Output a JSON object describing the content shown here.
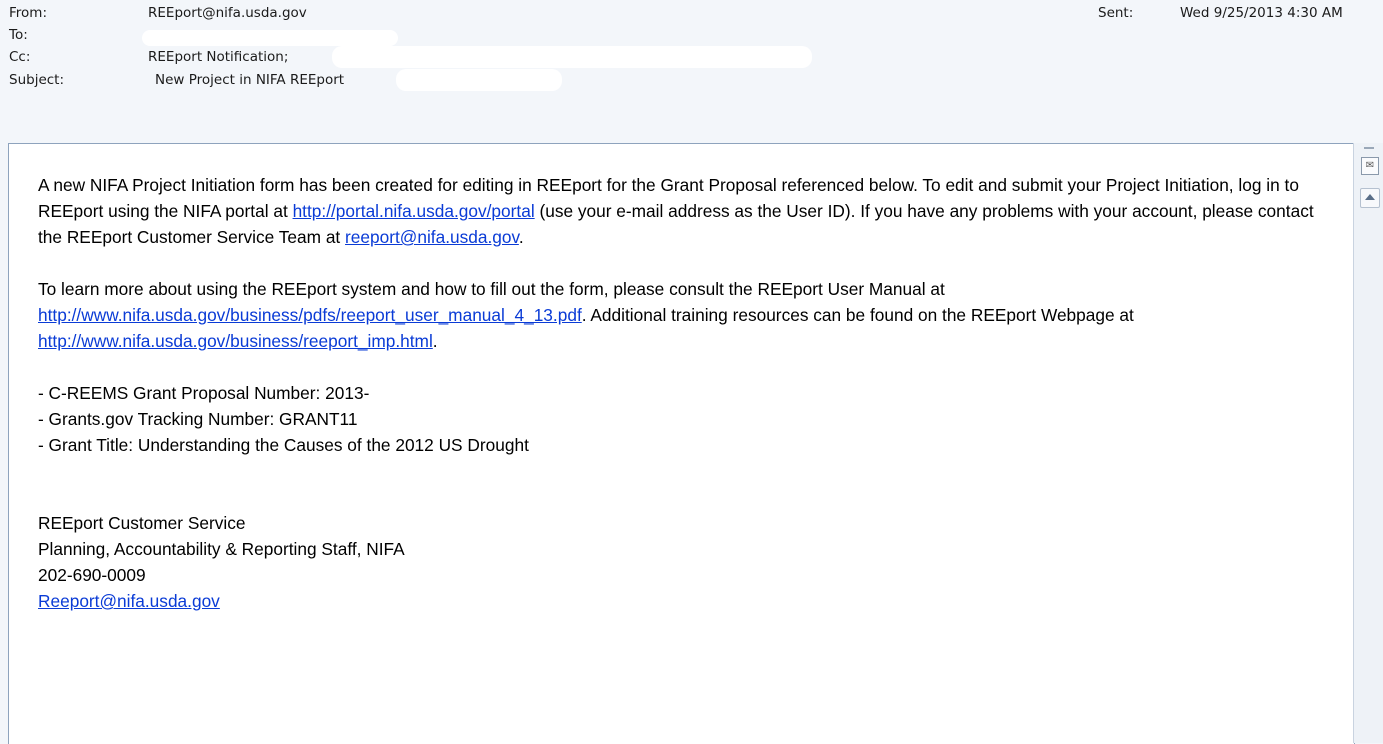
{
  "header": {
    "from_label": "From:",
    "from_value": "REEport@nifa.usda.gov",
    "to_label": "To:",
    "cc_label": "Cc:",
    "cc_value": "REEport Notification;",
    "subject_label": "Subject:",
    "subject_value": "New Project in NIFA REEport",
    "sent_label": "Sent:",
    "sent_value": "Wed 9/25/2013 4:30 AM"
  },
  "body": {
    "p1_text_a": "A new NIFA Project Initiation form has been created for editing in REEport for the Grant Proposal referenced below.  To edit and submit your Project Initiation, log in to REEport using the NIFA portal at ",
    "p1_link1": "http://portal.nifa.usda.gov/portal",
    "p1_text_b": " (use your e-mail address as the User ID). If you have any problems with your account, please contact the REEport Customer Service Team at ",
    "p1_link2": "reeport@nifa.usda.gov",
    "p1_text_c": ".",
    "p2_text_a": "To learn more about using the REEport system and how to fill out the form, please consult the REEport User Manual at ",
    "p2_link1": "http://www.nifa.usda.gov/business/pdfs/reeport_user_manual_4_13.pdf",
    "p2_text_b": ".  Additional training resources can be found on the REEport Webpage at ",
    "p2_link2": "http://www.nifa.usda.gov/business/reeport_imp.html",
    "p2_text_c": ".",
    "proposal_line": "- C-REEMS Grant Proposal Number: 2013-",
    "tracking_line": "- Grants.gov Tracking Number: GRANT11",
    "title_line": "- Grant Title: Understanding the Causes of the 2012 US Drought",
    "sig_name": "REEport Customer Service",
    "sig_staff": "Planning, Accountability & Reporting Staff, NIFA",
    "sig_phone": "202-690-0009",
    "sig_email": "Reeport@nifa.usda.gov"
  },
  "icons": {
    "scroll_up": "scroll-up-arrow-icon",
    "reading_pane": "reading-pane-icon"
  }
}
